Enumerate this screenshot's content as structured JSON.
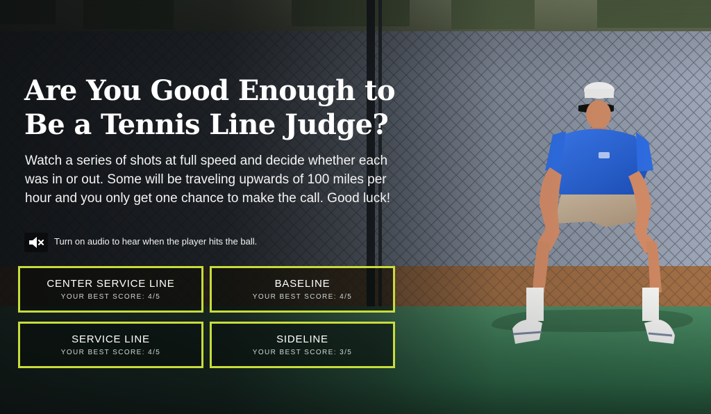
{
  "intro": {
    "title": "Are You Good Enough to Be a Tennis Line Judge?",
    "description": "Watch a series of shots at full speed and decide whether each was in or out. Some will be traveling upwards of 100 miles per hour and you only get one chance to make the call. Good luck!"
  },
  "audio": {
    "icon": "speaker-muted-icon",
    "message": "Turn on audio to hear when the player hits the ball."
  },
  "challenges": [
    {
      "name": "CENTER SERVICE LINE",
      "best_score_label": "YOUR BEST SCORE:",
      "best_score_value": "4/5"
    },
    {
      "name": "BASELINE",
      "best_score_label": "YOUR BEST SCORE:",
      "best_score_value": "4/5"
    },
    {
      "name": "SERVICE LINE",
      "best_score_label": "YOUR BEST SCORE:",
      "best_score_value": "4/5"
    },
    {
      "name": "SIDELINE",
      "best_score_label": "YOUR BEST SCORE:",
      "best_score_value": "3/5"
    }
  ],
  "colors": {
    "button_border": "#c8dc3b",
    "title_text": "#ffffff",
    "court_green": "#2d6f4a",
    "fence_gray": "#5e6674",
    "shirt_blue": "#2362d6"
  }
}
